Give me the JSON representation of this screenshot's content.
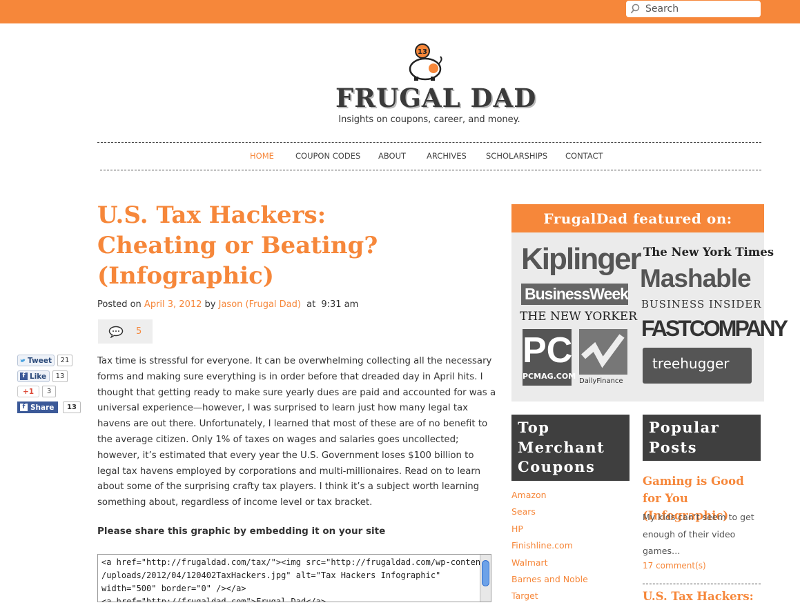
{
  "search": {
    "placeholder": "Search"
  },
  "site": {
    "title": "FRUGAL DAD",
    "tagline": "Insights on coupons, career, and money.",
    "logo_badge": "13"
  },
  "nav": [
    {
      "label": "HOME",
      "active": true
    },
    {
      "label": "COUPON CODES"
    },
    {
      "label": "ABOUT"
    },
    {
      "label": "ARCHIVES"
    },
    {
      "label": "SCHOLARSHIPS"
    },
    {
      "label": "CONTACT"
    }
  ],
  "post": {
    "title": "U.S. Tax Hackers: Cheating or Beating? (Infographic)",
    "meta": {
      "posted_on": "Posted on",
      "date": "April 3, 2012",
      "by": "by",
      "author": "Jason (Frugal Dad)",
      "at": "at",
      "time": "9:31 am"
    },
    "comment_count": "5",
    "body": "Tax time is stressful for everyone. It can be overwhelming collecting all the necessary forms and making sure everything is in order before that dreaded day in April hits. I thought that getting ready to make sure yearly dues are paid and accounted for was a universal experience—however, I was surprised to learn just how many legal tax havens are out there. Unfortunately, I learned that most of these are of no benefit to the average citizen. Only 1% of taxes on wages and salaries goes uncollected; however, it’s estimated that every year the U.S. Government loses $100 billion to legal tax havens employed by corporations and multi-millionaires. Read on to learn about some of the surprising crafty tax players. I think it’s a subject worth learning something about, regardless of income level or tax bracket.",
    "share_heading": "Please share this graphic by embedding it on your site",
    "embed_lines": [
      "<a href=\"http://frugaldad.com/tax/\"><img src=\"http://frugaldad.com/wp-content",
      "/uploads/2012/04/120402TaxHackers.jpg\" alt=\"Tax Hackers Infographic\"",
      "width=\"500\"  border=\"0\" /></a>",
      "<a href=\"http://frugaldad.com\">Frugal Dad</a>"
    ]
  },
  "social": {
    "tweet": {
      "label": "Tweet",
      "count": "21"
    },
    "like": {
      "label": "Like",
      "count": "13"
    },
    "plusone": {
      "label": "+1",
      "count": "3"
    },
    "share": {
      "label": "Share",
      "count": "13"
    }
  },
  "sidebar": {
    "featured_title": "FrugalDad featured on:",
    "publications": [
      "Kiplinger",
      "The New York Times",
      "BusinessWeek",
      "Mashable",
      "BUSINESS INSIDER",
      "THE NEW YORKER",
      "FASTCOMPANY",
      "PC",
      "PCMAG.COM",
      "DailyFinance",
      "treehugger"
    ],
    "merchant": {
      "title_lines": [
        "Top",
        "Merchant",
        "Coupons"
      ],
      "items": [
        "Amazon",
        "Sears",
        "HP",
        "Finishline.com",
        "Walmart",
        "Barnes and Noble",
        "Target"
      ]
    },
    "popular": {
      "title_lines": [
        "Popular",
        "Posts"
      ],
      "post_title": "Gaming is Good for You (Infographic)",
      "excerpt": "My kids can’t seem to get enough of their video games…",
      "comments": "17 comment(s)",
      "next_title": "U.S. Tax Hackers:"
    }
  },
  "colors": {
    "accent": "#f6873a",
    "widget_dark": "#3f3f3f",
    "featured_bg": "#ebebeb"
  },
  "icons": [
    "search-icon",
    "piggy-bank-logo",
    "comment-bubble-icon",
    "twitter-bird-icon",
    "facebook-icon"
  ]
}
